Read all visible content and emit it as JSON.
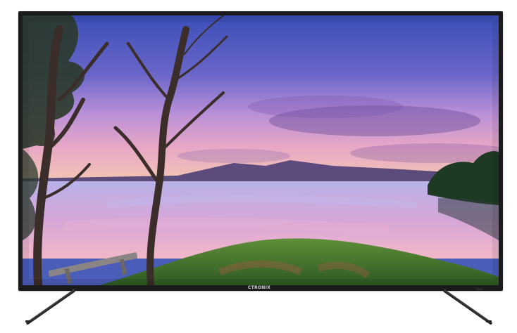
{
  "product": {
    "brand_logo": "CTRONIX",
    "colors": {
      "bezel": "#1b1b1e",
      "stand": "#2a2a2e",
      "logo": "#d8d8d8"
    }
  },
  "screen": {
    "scene": "lakeside-sunset",
    "icons": [
      "tree-icon",
      "bench-icon",
      "mountain-icon"
    ]
  }
}
